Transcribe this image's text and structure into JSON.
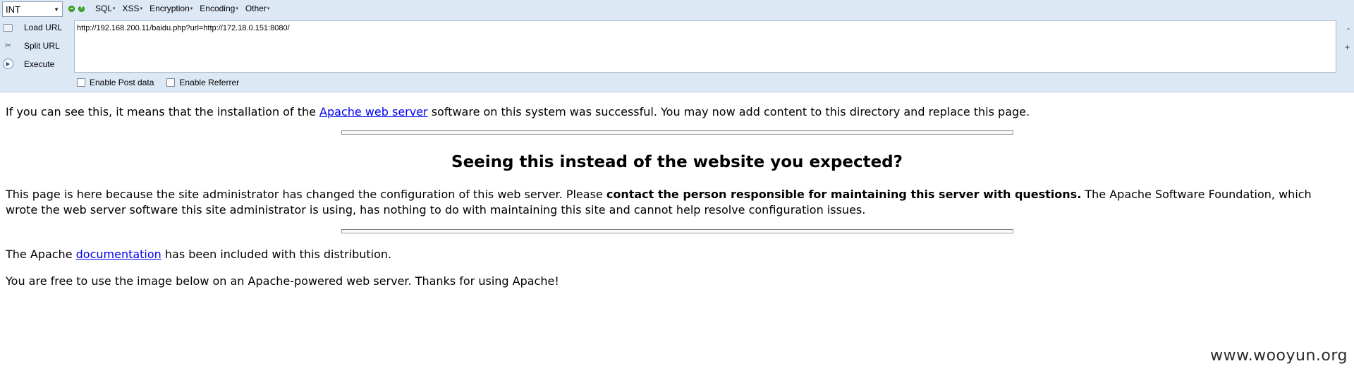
{
  "hackbar": {
    "select_value": "INT",
    "menus": [
      "SQL",
      "XSS",
      "Encryption",
      "Encoding",
      "Other"
    ],
    "actions": {
      "load_url": "Load URL",
      "split_url": "Split URL",
      "execute": "Execute"
    },
    "url_value": "http://192.168.200.11/baidu.php?url=http://172.18.0.151:8080/",
    "side_minus": "-",
    "side_plus": "+",
    "enable_post": "Enable Post data",
    "enable_referrer": "Enable Referrer",
    "icons": [
      "textbox-icon",
      "scissors-icon",
      "play-icon",
      "minus-icon",
      "plus-icon"
    ]
  },
  "page": {
    "p1_before": "If you can see this, it means that the installation of the ",
    "p1_link": "Apache web server",
    "p1_after": " software on this system was successful. You may now add content to this directory and replace this page.",
    "heading": "Seeing this instead of the website you expected?",
    "p2_before": "This page is here because the site administrator has changed the configuration of this web server. Please ",
    "p2_bold": "contact the person responsible for maintaining this server with questions.",
    "p2_after": " The Apache Software Foundation, which wrote the web server software this site administrator is using, has nothing to do with maintaining this site and cannot help resolve configuration issues.",
    "p3_before": "The Apache ",
    "p3_link": "documentation",
    "p3_after": " has been included with this distribution.",
    "p4": "You are free to use the image below on an Apache-powered web server. Thanks for using Apache!"
  },
  "watermark": "www.wooyun.org",
  "colors": {
    "toolbar_bg": "#dde8f5",
    "link": "#0000ee",
    "green_icon": "#3fae2a"
  }
}
